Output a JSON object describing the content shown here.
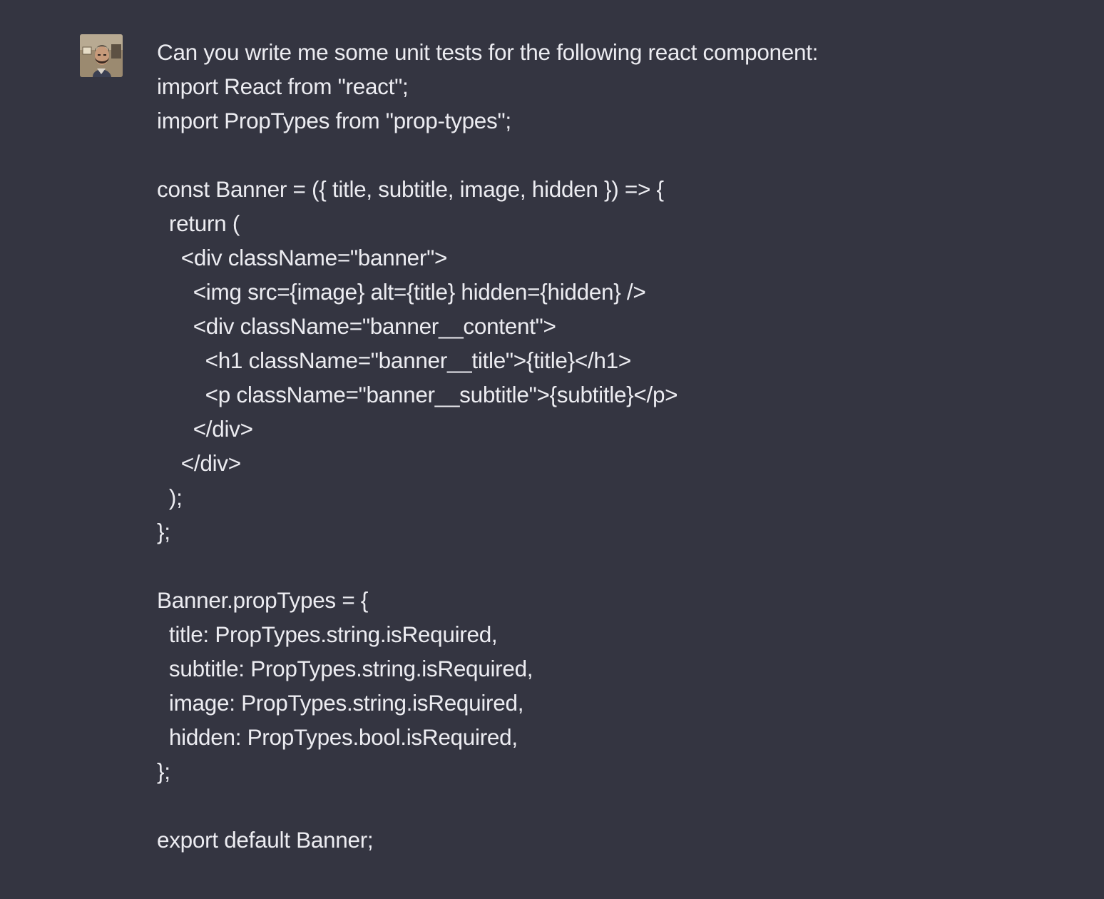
{
  "message": {
    "author_avatar_icon": "user-avatar-photo",
    "colors": {
      "background": "#343541",
      "text": "#ececf1"
    },
    "lines": [
      "Can you write me some unit tests for the following react component:",
      "import React from \"react\";",
      "import PropTypes from \"prop-types\";",
      "",
      "const Banner = ({ title, subtitle, image, hidden }) => {",
      "  return (",
      "    <div className=\"banner\">",
      "      <img src={image} alt={title} hidden={hidden} />",
      "      <div className=\"banner__content\">",
      "        <h1 className=\"banner__title\">{title}</h1>",
      "        <p className=\"banner__subtitle\">{subtitle}</p>",
      "      </div>",
      "    </div>",
      "  );",
      "};",
      "",
      "Banner.propTypes = {",
      "  title: PropTypes.string.isRequired,",
      "  subtitle: PropTypes.string.isRequired,",
      "  image: PropTypes.string.isRequired,",
      "  hidden: PropTypes.bool.isRequired,",
      "};",
      "",
      "export default Banner;"
    ]
  }
}
